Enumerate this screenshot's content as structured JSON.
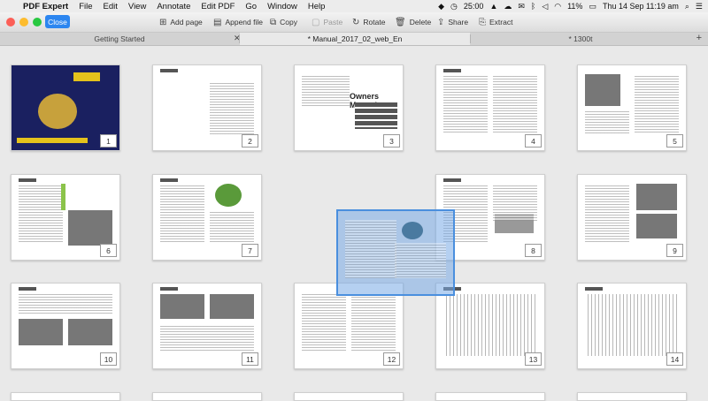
{
  "menubar": {
    "app_name": "PDF Expert",
    "items": [
      "File",
      "Edit",
      "View",
      "Annotate",
      "Edit PDF",
      "Go",
      "Window",
      "Help"
    ],
    "status": {
      "time_elapsed": "25:00",
      "battery": "11%",
      "datetime": "Thu 14 Sep  11:19 am"
    }
  },
  "toolbar": {
    "close_label": "Close",
    "buttons": [
      {
        "label": "Add page",
        "icon": "add-page-icon",
        "enabled": true
      },
      {
        "label": "Append file",
        "icon": "append-file-icon",
        "enabled": true
      },
      {
        "label": "Copy",
        "icon": "copy-icon",
        "enabled": true
      },
      {
        "label": "Paste",
        "icon": "paste-icon",
        "enabled": false
      },
      {
        "label": "Rotate",
        "icon": "rotate-icon",
        "enabled": true
      },
      {
        "label": "Delete",
        "icon": "trash-icon",
        "enabled": true
      },
      {
        "label": "Share",
        "icon": "share-icon",
        "enabled": true
      },
      {
        "label": "Extract",
        "icon": "extract-icon",
        "enabled": true
      }
    ]
  },
  "tabs": [
    {
      "label": "Getting Started",
      "active": false
    },
    {
      "label": "* Manual_2017_02_web_En",
      "active": true
    },
    {
      "label": "* 1300t",
      "active": false
    }
  ],
  "pages": [
    "1",
    "2",
    "3",
    "4",
    "5",
    "6",
    "7",
    "8",
    "9",
    "10",
    "11",
    "12",
    "13",
    "14"
  ],
  "page3": {
    "title": "Owners Manual"
  }
}
